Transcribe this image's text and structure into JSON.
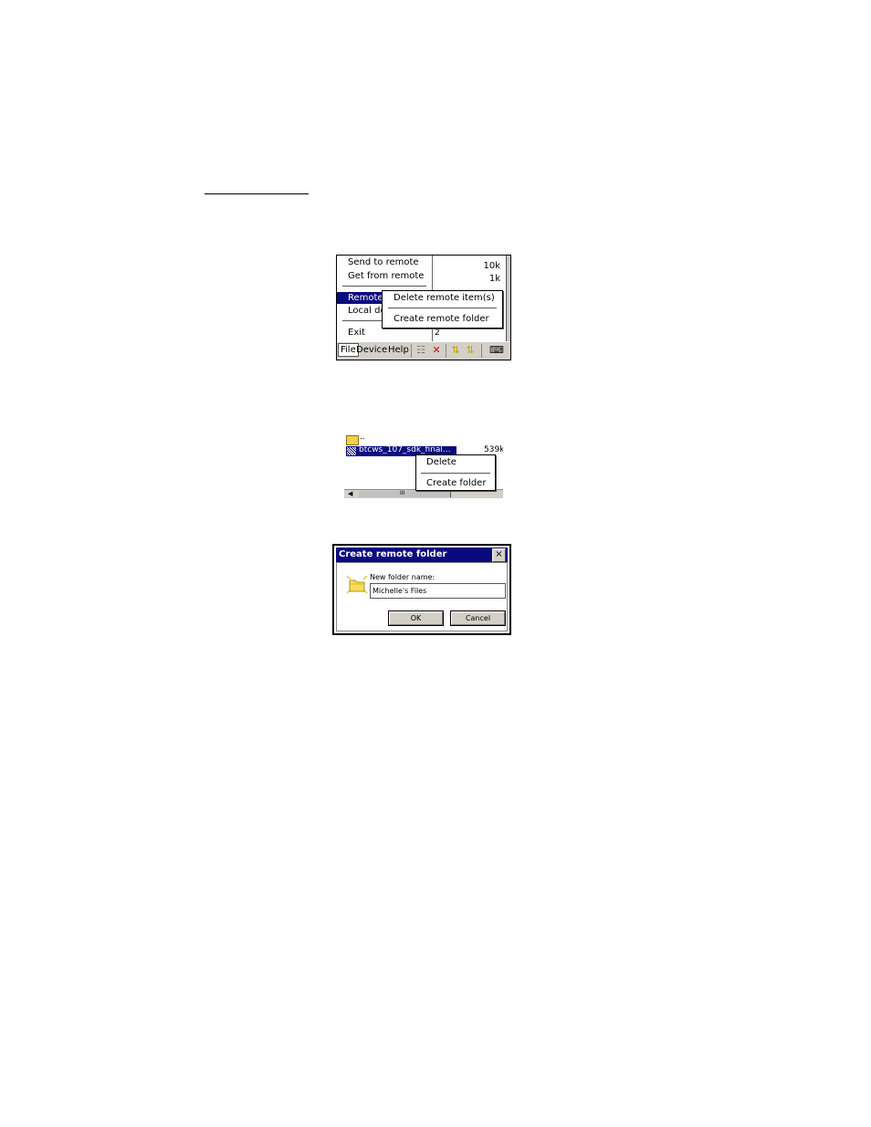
{
  "screenshot1": {
    "file_menu": {
      "items": [
        "Send to remote",
        "Get from remote",
        "Remote",
        "Local de",
        "Exit"
      ]
    },
    "remote_submenu": {
      "items": [
        "Delete remote item(s)",
        "Create remote folder"
      ]
    },
    "background_sizes": [
      "10k",
      "1k",
      "2"
    ],
    "menubar": {
      "file": "File",
      "device": "Device",
      "help": "Help"
    },
    "toolbar_icons": [
      "connect-icon",
      "disconnect-icon",
      "send-icon",
      "receive-icon",
      "keyboard-icon"
    ]
  },
  "screenshot2": {
    "rows": [
      {
        "name": "..",
        "size": ""
      },
      {
        "name": "btcws_107_sdk_final...",
        "size": "539k"
      }
    ],
    "context_menu": {
      "items": [
        "Delete",
        "Create folder"
      ]
    },
    "scroll_thumb_glyph": "III"
  },
  "screenshot3": {
    "title": "Create remote folder",
    "close_glyph": "×",
    "label": "New folder name:",
    "input_value": "Michelle's Files",
    "ok_label": "OK",
    "cancel_label": "Cancel"
  }
}
